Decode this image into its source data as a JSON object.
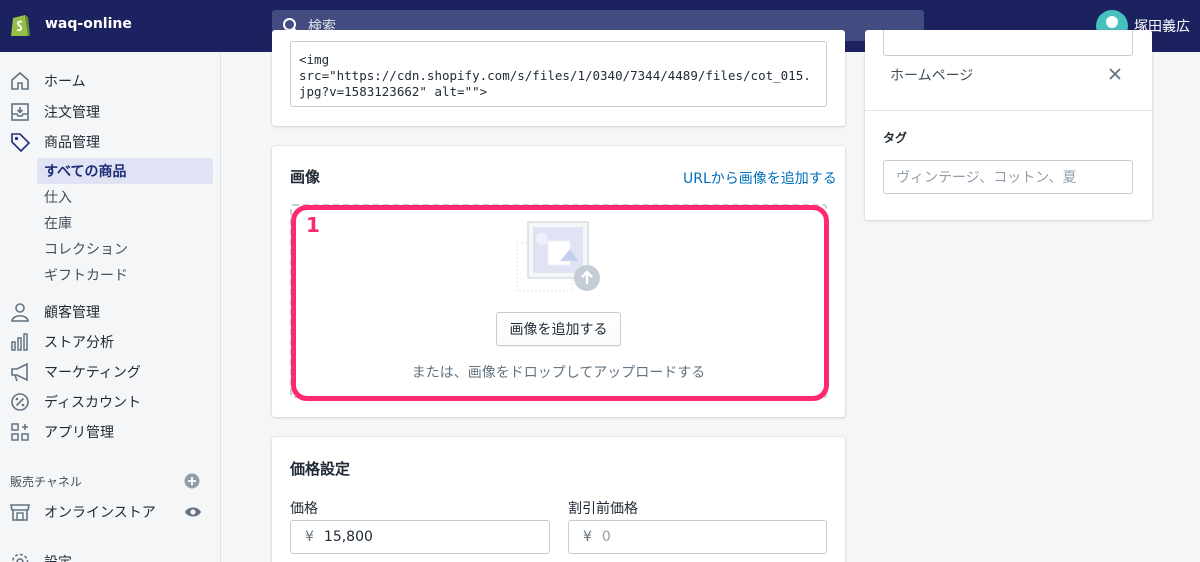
{
  "topbar": {
    "store_name": "waq-online",
    "search_placeholder": "検索",
    "user_name": "塚田義広"
  },
  "sidebar": {
    "items": [
      {
        "label": "ホーム",
        "icon": "home-icon"
      },
      {
        "label": "注文管理",
        "icon": "inbox-icon"
      },
      {
        "label": "商品管理",
        "icon": "tag-icon"
      }
    ],
    "product_subitems": [
      {
        "label": "すべての商品",
        "active": true
      },
      {
        "label": "仕入",
        "active": false
      },
      {
        "label": "在庫",
        "active": false
      },
      {
        "label": "コレクション",
        "active": false
      },
      {
        "label": "ギフトカード",
        "active": false
      }
    ],
    "items2": [
      {
        "label": "顧客管理",
        "icon": "customer-icon"
      },
      {
        "label": "ストア分析",
        "icon": "analytics-icon"
      },
      {
        "label": "マーケティング",
        "icon": "megaphone-icon"
      },
      {
        "label": "ディスカウント",
        "icon": "discount-icon"
      },
      {
        "label": "アプリ管理",
        "icon": "apps-icon"
      }
    ],
    "sales_channels_title": "販売チャネル",
    "online_store": "オンラインストア",
    "settings": "設定"
  },
  "description": {
    "code": "<img\nsrc=\"https://cdn.shopify.com/s/files/1/0340/7344/4489/files/cot_015.jpg?v=1583123662\" alt=\"\">"
  },
  "images_card": {
    "title": "画像",
    "url_link": "URLから画像を追加する",
    "annotation_number": "1",
    "add_button": "画像を追加する",
    "drop_hint": "または、画像をドロップしてアップロードする"
  },
  "pricing_card": {
    "title": "価格設定",
    "price_label": "価格",
    "price_currency": "¥",
    "price_value": "15,800",
    "compare_label": "割引前価格",
    "compare_currency": "¥",
    "compare_placeholder": "0"
  },
  "right_panel": {
    "channel": "ホームページ",
    "tags_label": "タグ",
    "tags_placeholder": "ヴィンテージ、コットン、夏"
  },
  "colors": {
    "topbar": "#1c2260",
    "highlight": "#ff2a6d",
    "link": "#006fbb"
  }
}
